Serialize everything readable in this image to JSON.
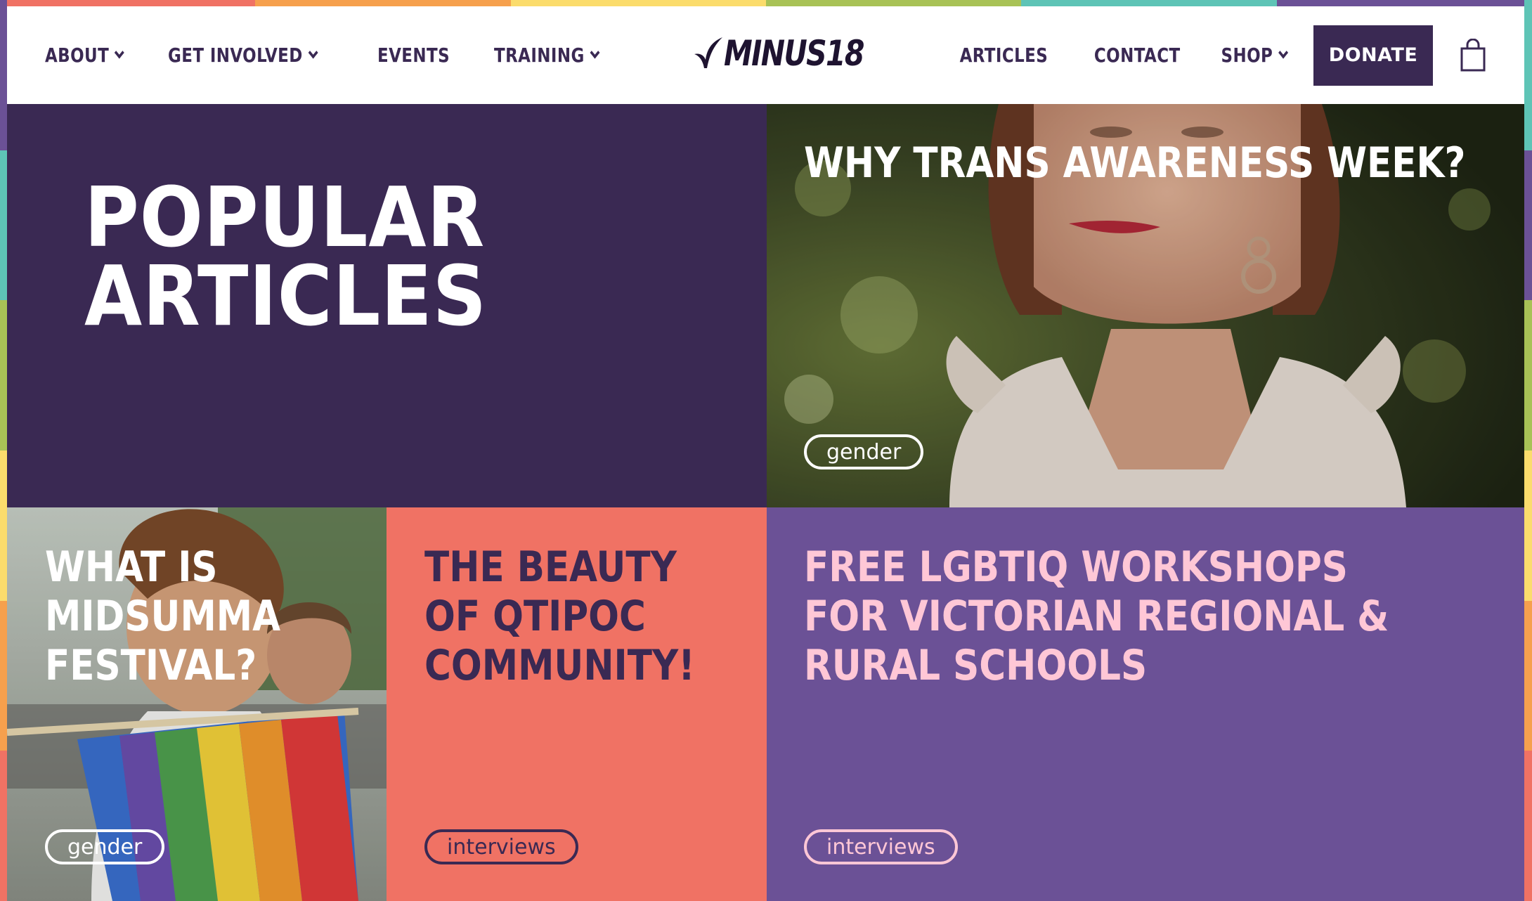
{
  "colors": {
    "brand_dark": "#3a2953",
    "coral": "#f07264",
    "purple": "#6b5196",
    "pink_text": "#ffc7d6",
    "rainbow": [
      "#f07264",
      "#f6a04d",
      "#fbdc6c",
      "#a8c256",
      "#5ec4b6",
      "#6b5196"
    ]
  },
  "nav": {
    "left": [
      {
        "label": "ABOUT",
        "icon": "chevron-down-icon"
      },
      {
        "label": "GET INVOLVED",
        "icon": "chevron-down-icon"
      },
      {
        "label": "EVENTS"
      },
      {
        "label": "TRAINING",
        "icon": "chevron-down-icon"
      }
    ],
    "right": [
      {
        "label": "ARTICLES"
      },
      {
        "label": "CONTACT"
      },
      {
        "label": "SHOP",
        "icon": "chevron-down-icon"
      }
    ],
    "donate_label": "DONATE",
    "cart_icon": "shopping-bag-icon"
  },
  "logo": {
    "text": "MINUS18",
    "icon": "sprout-icon"
  },
  "section_title": "POPULAR ARTICLES",
  "articles": [
    {
      "title": "WHY TRANS AWARENESS WEEK?",
      "tag": "gender"
    },
    {
      "title": "WHAT IS MIDSUMMA FESTIVAL?",
      "tag": "gender"
    },
    {
      "title": "THE BEAUTY OF QTIPOC COMMUNITY!",
      "tag": "interviews"
    },
    {
      "title": "FREE LGBTIQ WORKSHOPS FOR VICTORIAN REGIONAL & RURAL SCHOOLS",
      "tag": "interviews"
    }
  ]
}
